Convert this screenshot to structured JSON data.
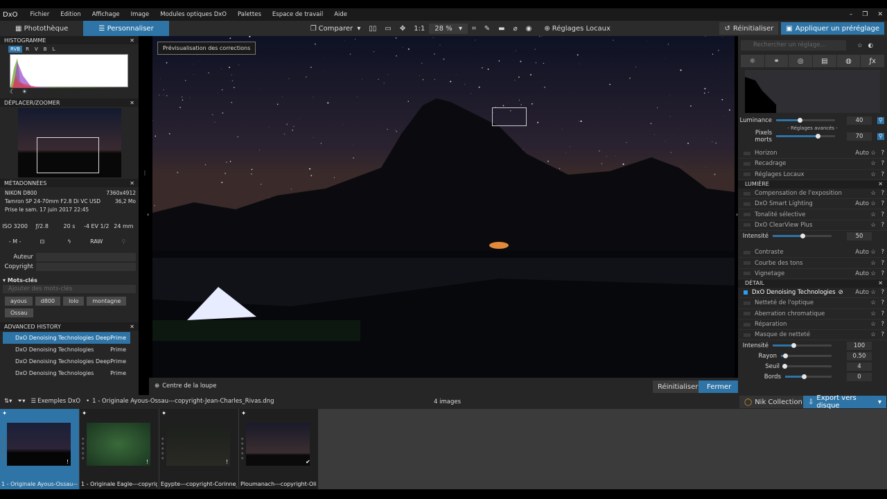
{
  "menu": {
    "logo": "DxO",
    "items": [
      "Fichier",
      "Edition",
      "Affichage",
      "Image",
      "Modules optiques DxO",
      "Palettes",
      "Espace de travail",
      "Aide"
    ]
  },
  "tabs": {
    "library": "Photothèque",
    "customize": "Personnaliser"
  },
  "toolbar": {
    "compare": "Comparer",
    "one_to_one": "1:1",
    "zoom": "28 %",
    "local": "Réglages Locaux",
    "reset": "Réinitialiser",
    "apply_preset": "Appliquer un préréglage"
  },
  "histogram": {
    "title": "HISTOGRAMME",
    "channels": [
      "RVB",
      "R",
      "V",
      "B",
      "L"
    ]
  },
  "move_zoom": {
    "title": "DÉPLACER/ZOOMER"
  },
  "metadata": {
    "title": "MÉTADONNÉES",
    "camera": "NIKON D800",
    "resolution": "7360x4912",
    "lens": "Tamron SP 24-70mm F2.8 Di VC USD",
    "size": "36,2 Mo",
    "date": "Prise le sam. 17 juin 2017 22:45",
    "iso": "ISO 3200",
    "aperture": "ƒ/2.8",
    "shutter": "20 s",
    "ev": "-4 EV 1/2",
    "focal": "24 mm",
    "mode": "- M -",
    "format": "RAW",
    "author_label": "Auteur",
    "copyright_label": "Copyright"
  },
  "keywords": {
    "title": "Mots-clés",
    "placeholder": "Ajouter des mots-clés",
    "tags": [
      "ayous",
      "d800",
      "lolo",
      "montagne",
      "Ossau"
    ]
  },
  "history": {
    "title": "ADVANCED HISTORY",
    "items": [
      {
        "name": "DxO Denoising Technologies",
        "value": "DeepPrime"
      },
      {
        "name": "DxO Denoising Technologies",
        "value": "Prime"
      },
      {
        "name": "DxO Denoising Technologies",
        "value": "DeepPrime"
      },
      {
        "name": "DxO Denoising Technologies",
        "value": "Prime"
      }
    ]
  },
  "viewer": {
    "tooltip": "Prévisualisation des corrections",
    "loupe": "Centre de la loupe",
    "reset": "Réinitialiser",
    "close": "Fermer"
  },
  "right": {
    "search_placeholder": "Rechercher un réglage...",
    "luminance_label": "Luminance",
    "luminance": 40,
    "advanced": "- Réglages avancés -",
    "dead_pixels_label": "Pixels morts",
    "dead_pixels": 70,
    "rows1": [
      {
        "l": "Horizon",
        "a": "Auto"
      },
      {
        "l": "Recadrage",
        "a": ""
      },
      {
        "l": "Réglages Locaux",
        "a": ""
      }
    ],
    "lumiere": "LUMIÈRE",
    "rows2": [
      {
        "l": "Compensation de l'exposition",
        "a": ""
      },
      {
        "l": "DxO Smart Lighting",
        "a": "Auto"
      },
      {
        "l": "Tonalité sélective",
        "a": ""
      },
      {
        "l": "DxO ClearView Plus",
        "a": ""
      }
    ],
    "intensity_label": "Intensité",
    "clearview_intensity": 50,
    "rows3": [
      {
        "l": "Contraste",
        "a": "Auto"
      },
      {
        "l": "Courbe des tons",
        "a": ""
      },
      {
        "l": "Vignetage",
        "a": "Auto"
      }
    ],
    "detail": "DÉTAIL",
    "denoise": "DxO Denoising Technologies",
    "denoise_auto": "Auto",
    "rows4": [
      {
        "l": "Netteté de l'optique",
        "a": ""
      },
      {
        "l": "Aberration chromatique",
        "a": ""
      },
      {
        "l": "Réparation",
        "a": ""
      },
      {
        "l": "Masque de netteté",
        "a": ""
      }
    ],
    "sharpen": [
      {
        "l": "Intensité",
        "v": "100",
        "f": 0.35
      },
      {
        "l": "Rayon",
        "v": "0.50",
        "f": 0.08
      },
      {
        "l": "Seuil",
        "v": "4",
        "f": 0.02
      },
      {
        "l": "Bords",
        "v": "0",
        "f": 0.4
      }
    ]
  },
  "filmbar": {
    "folder": "Exemples DxO",
    "file": "1 - Originale Ayous-Ossau---copyright-Jean-Charles_Rivas.dng",
    "count": "4 images",
    "nik": "Nik Collection",
    "export": "Export vers disque"
  },
  "thumbs": [
    "1 - Originale Ayous-Ossau---...",
    "1 - Originale Eagle---copyrig...",
    "Egypte---copyright-Corinne_...",
    "Ploumanach---copyright-Oli..."
  ]
}
